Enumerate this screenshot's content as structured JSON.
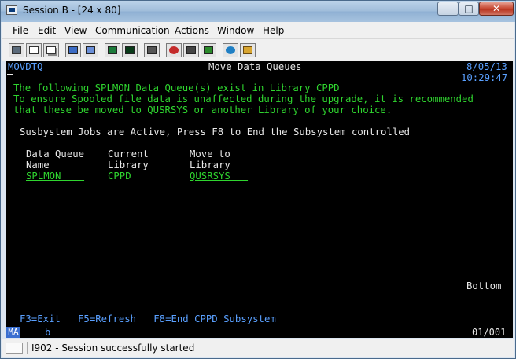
{
  "window": {
    "title": "Session B - [24 x 80]"
  },
  "titlebar": {
    "min": "—",
    "max": "□",
    "close": "✕"
  },
  "menu": [
    {
      "ul": "F",
      "rest": "ile"
    },
    {
      "ul": "E",
      "rest": "dit"
    },
    {
      "ul": "V",
      "rest": "iew"
    },
    {
      "ul": "C",
      "rest": "ommunication"
    },
    {
      "ul": "A",
      "rest": "ctions"
    },
    {
      "ul": "W",
      "rest": "indow"
    },
    {
      "ul": "H",
      "rest": "elp"
    }
  ],
  "screen": {
    "program": "MOVDTQ",
    "title": "Move Data Queues",
    "date": "8/05/13",
    "time": "10:29:47",
    "line1": "The following SPLMON Data Queue(s) exist in Library CPPD",
    "line2": "To ensure Spooled file data is unaffected during the upgrade, it is recommended",
    "line3": "that these be moved to QUSRSYS or another Library of your choice.",
    "notice": "Susbystem Jobs are Active, Press F8 to End the Subsystem controlled",
    "col1_h1": "Data Queue",
    "col1_h2": "Name",
    "col2_h1": "Current",
    "col2_h2": "Library",
    "col3_h1": "Move to",
    "col3_h2": "Library",
    "row_queue": "SPLMON    ",
    "row_current": "CPPD",
    "row_move": "QUSRSYS   ",
    "more": "Bottom",
    "fkeys": "F3=Exit   F5=Refresh   F8=End CPPD Subsystem"
  },
  "oia": {
    "mode": "MA",
    "indicator": "b",
    "position": "01/001"
  },
  "status": {
    "icon_label": "I902",
    "message": "I902 - Session successfully started"
  }
}
